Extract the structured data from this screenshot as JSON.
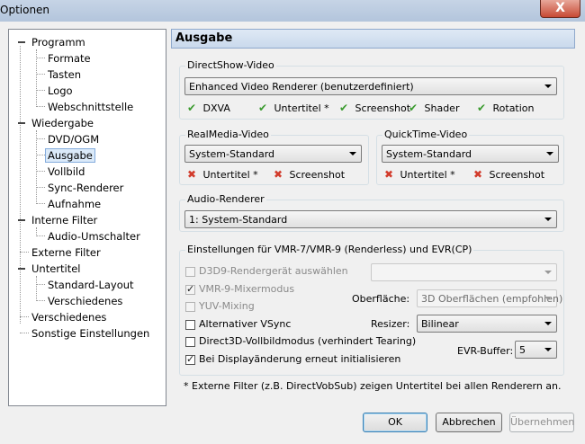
{
  "window": {
    "title": "Optionen",
    "close_label": "X"
  },
  "tree": {
    "items": [
      {
        "label": "Programm",
        "level": 0,
        "expanded": true
      },
      {
        "label": "Formate",
        "level": 1
      },
      {
        "label": "Tasten",
        "level": 1
      },
      {
        "label": "Logo",
        "level": 1
      },
      {
        "label": "Webschnittstelle",
        "level": 1
      },
      {
        "label": "Wiedergabe",
        "level": 0,
        "expanded": true
      },
      {
        "label": "DVD/OGM",
        "level": 1
      },
      {
        "label": "Ausgabe",
        "level": 1,
        "selected": true
      },
      {
        "label": "Vollbild",
        "level": 1
      },
      {
        "label": "Sync-Renderer",
        "level": 1
      },
      {
        "label": "Aufnahme",
        "level": 1
      },
      {
        "label": "Interne Filter",
        "level": 0,
        "expanded": true
      },
      {
        "label": "Audio-Umschalter",
        "level": 1
      },
      {
        "label": "Externe Filter",
        "level": 0
      },
      {
        "label": "Untertitel",
        "level": 0,
        "expanded": true
      },
      {
        "label": "Standard-Layout",
        "level": 1
      },
      {
        "label": "Verschiedenes",
        "level": 1
      },
      {
        "label": "Verschiedenes",
        "level": 0
      },
      {
        "label": "Sonstige Einstellungen",
        "level": 0
      }
    ]
  },
  "page": {
    "title": "Ausgabe",
    "directshow": {
      "group_label": "DirectShow-Video",
      "renderer": "Enhanced Video Renderer (benutzerdefiniert)",
      "features": [
        "DXVA",
        "Untertitel *",
        "Screenshot",
        "Shader",
        "Rotation"
      ]
    },
    "realmedia": {
      "group_label": "RealMedia-Video",
      "renderer": "System-Standard",
      "features": [
        "Untertitel *",
        "Screenshot"
      ]
    },
    "quicktime": {
      "group_label": "QuickTime-Video",
      "renderer": "System-Standard",
      "features": [
        "Untertitel *",
        "Screenshot"
      ]
    },
    "audio": {
      "group_label": "Audio-Renderer",
      "renderer": "1: System-Standard"
    },
    "vmr": {
      "group_label": "Einstellungen für VMR-7/VMR-9 (Renderless) und EVR(CP)",
      "d3d9_label": "D3D9-Rendergerät auswählen",
      "d3d9_value": "",
      "vmr9_mixer_label": "VMR-9-Mixermodus",
      "yuv_label": "YUV-Mixing",
      "alt_vsync_label": "Alternativer VSync",
      "d3d_fullscreen_label": "Direct3D-Vollbildmodus (verhindert Tearing)",
      "reinit_label": "Bei Displayänderung erneut initialisieren",
      "surface_label": "Oberfläche:",
      "surface_value": "3D Oberflächen (empfohlen)",
      "resizer_label": "Resizer:",
      "resizer_value": "Bilinear",
      "evr_buffer_label": "EVR-Buffer:",
      "evr_buffer_value": "5"
    },
    "footnote": "* Externe Filter (z.B. DirectVobSub) zeigen Untertitel bei allen Renderern an."
  },
  "buttons": {
    "ok": "OK",
    "cancel": "Abbrechen",
    "apply": "Übernehmen"
  }
}
